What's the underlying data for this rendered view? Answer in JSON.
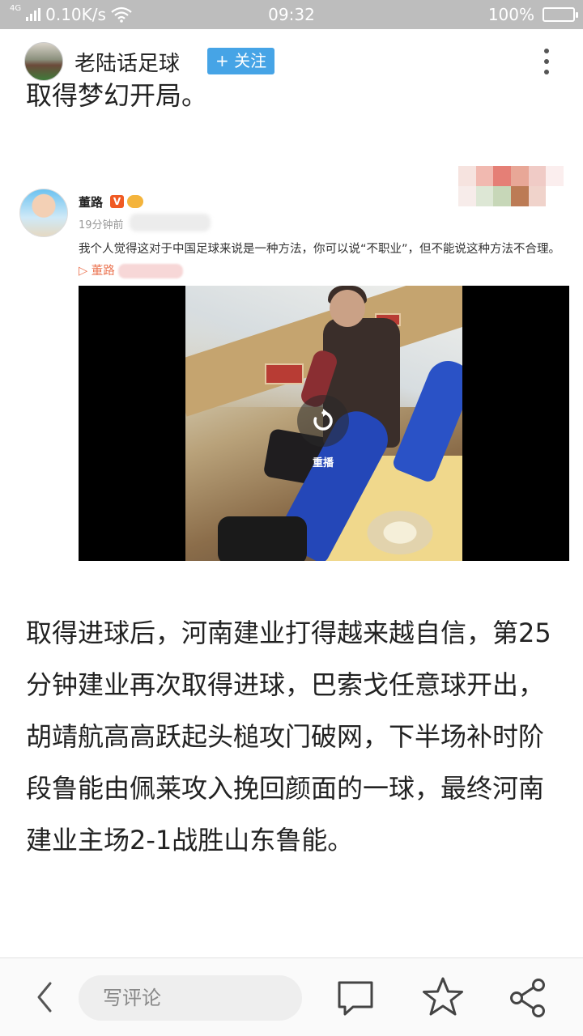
{
  "status_bar": {
    "network": "4G",
    "speed": "0.10K/s",
    "time": "09:32",
    "battery": "100%"
  },
  "header": {
    "author": "老陆话足球",
    "follow_label": "+ 关注"
  },
  "article": {
    "partial_line": "取得梦幻开局。",
    "paragraph": "取得进球后，河南建业打得越来越自信，第25分钟建业再次取得进球，巴索戈任意球开出，胡靖航高高跃起头槌攻门破网，下半场补时阶段鲁能由佩莱攻入挽回颜面的一球，最终河南建业主场2-1战胜山东鲁能。"
  },
  "embedded_post": {
    "name": "董路",
    "verified_badge": "V",
    "time": "19分钟前",
    "text": "我个人觉得这对于中国足球来说是一种方法，你可以说“不职业”，但不能说这种方法不合理。",
    "video_link": "董路",
    "replay_label": "重播"
  },
  "bottom_bar": {
    "comment_placeholder": "写评论"
  },
  "colors": {
    "follow_bg": "#46a4e6",
    "status_bar_bg": "#bdbdbd",
    "video_link": "#eb7350",
    "verified": "#f05a23"
  }
}
